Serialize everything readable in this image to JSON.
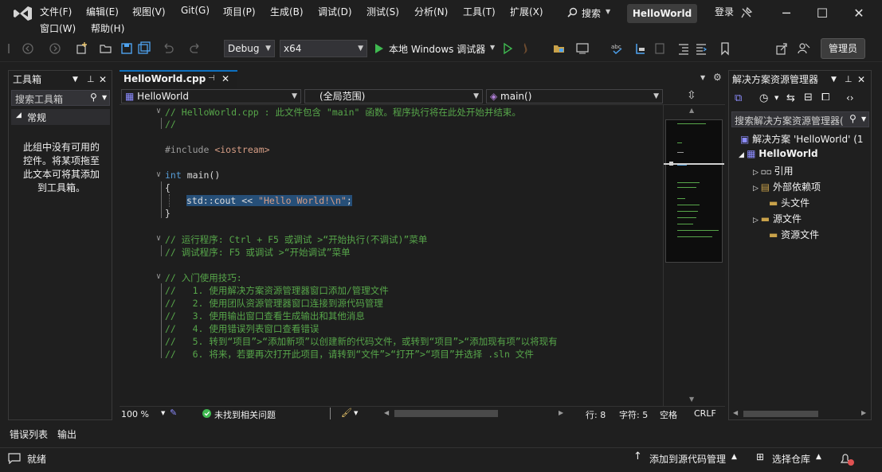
{
  "menu": {
    "file": "文件(F)",
    "edit": "编辑(E)",
    "view": "视图(V)",
    "git": "Git(G)",
    "project": "项目(P)",
    "build": "生成(B)",
    "debug": "调试(D)",
    "test": "测试(S)",
    "analyze": "分析(N)",
    "tools": "工具(T)",
    "extensions": "扩展(X)",
    "window": "窗口(W)",
    "help": "帮助(H)",
    "search": "搜索",
    "solution_title": "HelloWorld",
    "login": "登录"
  },
  "toolbar": {
    "config": "Debug",
    "platform": "x64",
    "run_label": "本地 Windows 调试器",
    "admin": "管理员"
  },
  "toolbox": {
    "title": "工具箱",
    "search_placeholder": "搜索工具箱",
    "group": "常规",
    "empty_msg": "此组中没有可用的控件。将某项拖至此文本可将其添加到工具箱。"
  },
  "editor": {
    "tab": "HelloWorld.cpp",
    "project_combo": "HelloWorld",
    "scope_combo": "(全局范围)",
    "member_combo": "main()",
    "zoom": "100 %",
    "issues": "未找到相关问题",
    "line": "行: 8",
    "col": "字符: 5",
    "ws": "空格",
    "eol": "CRLF",
    "lines": {
      "l1": "// HelloWorld.cpp : 此文件包含 \"main\" 函数。程序执行将在此处开始并结束。",
      "l2": "//",
      "l3a": "#include ",
      "l3b": "<iostream>",
      "l4a": "int",
      "l4b": " main()",
      "l5": "{",
      "l6a": "std",
      "l6b": "::cout << ",
      "l6c": "\"Hello World!\\n\"",
      "l6d": ";",
      "l7": "}",
      "l8": "// 运行程序: Ctrl + F5 或调试 >“开始执行(不调试)”菜单",
      "l9": "// 调试程序: F5 或调试 >“开始调试”菜单",
      "l10": "// 入门使用技巧:",
      "l11": "//   1. 使用解决方案资源管理器窗口添加/管理文件",
      "l12": "//   2. 使用团队资源管理器窗口连接到源代码管理",
      "l13": "//   3. 使用输出窗口查看生成输出和其他消息",
      "l14": "//   4. 使用错误列表窗口查看错误",
      "l15": "//   5. 转到“项目”>“添加新项”以创建新的代码文件，或转到“项目”>“添加现有项”以将现有",
      "l16": "//   6. 将来，若要再次打开此项目，请转到“文件”>“打开”>“项目”并选择 .sln 文件"
    }
  },
  "solution_explorer": {
    "title": "解决方案资源管理器",
    "search_placeholder": "搜索解决方案资源管理器(",
    "solution": "解决方案 'HelloWorld' (1",
    "project": "HelloWorld",
    "references": "引用",
    "external": "外部依赖项",
    "headers": "头文件",
    "sources": "源文件",
    "resources": "资源文件"
  },
  "bottom_tabs": {
    "errors": "错误列表",
    "output": "输出"
  },
  "status": {
    "ready": "就绪",
    "source_control": "添加到源代码管理",
    "repo": "选择仓库"
  },
  "colors": {
    "accent": "#0e70c0",
    "comment": "#57a64a",
    "keyword": "#569cd6",
    "string": "#d69d85"
  }
}
